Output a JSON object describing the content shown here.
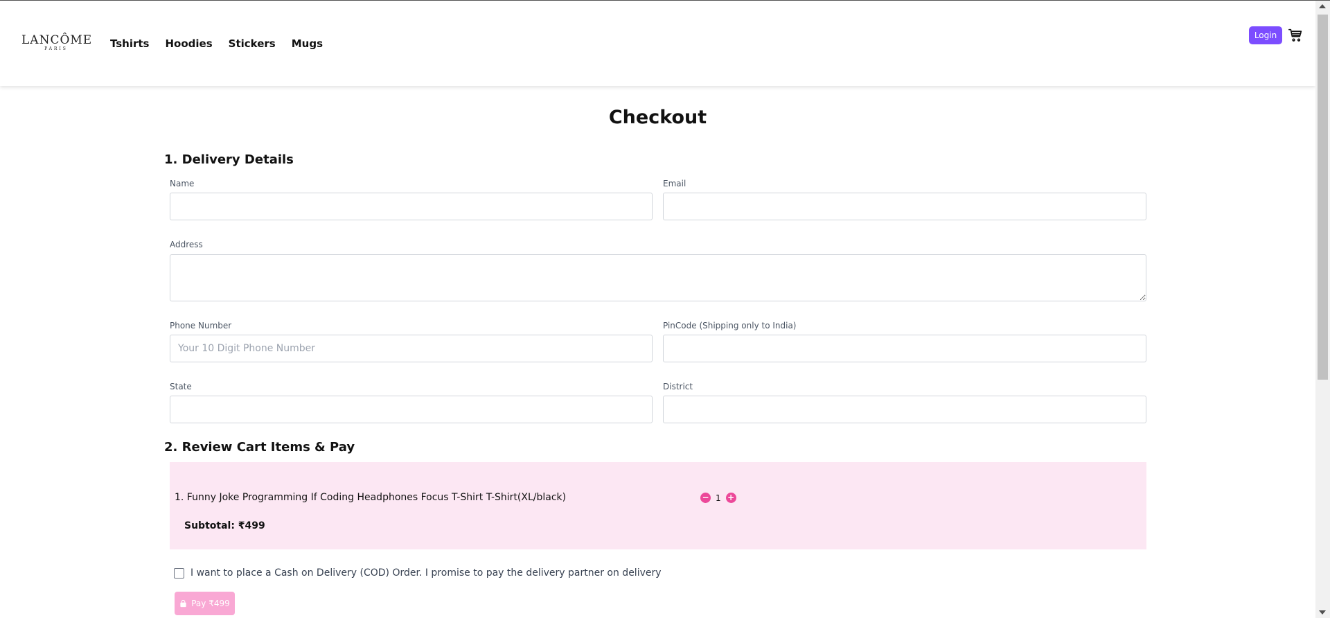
{
  "header": {
    "logo_main": "LANCÔME",
    "logo_sub": "PARIS",
    "nav": [
      {
        "label": "Tshirts"
      },
      {
        "label": "Hoodies"
      },
      {
        "label": "Stickers"
      },
      {
        "label": "Mugs"
      }
    ],
    "login_label": "Login",
    "accent_color": "#7c4dff",
    "cart_icon": "shopping-cart-icon"
  },
  "checkout": {
    "title": "Checkout",
    "delivery_section": "1. Delivery Details",
    "fields": {
      "name": {
        "label": "Name",
        "value": "",
        "placeholder": ""
      },
      "email": {
        "label": "Email",
        "value": "",
        "placeholder": ""
      },
      "address": {
        "label": "Address",
        "value": "",
        "placeholder": ""
      },
      "phone": {
        "label": "Phone Number",
        "value": "",
        "placeholder": "Your 10 Digit Phone Number"
      },
      "pincode": {
        "label": "PinCode (Shipping only to India)",
        "value": "",
        "placeholder": ""
      },
      "state": {
        "label": "State",
        "value": "",
        "placeholder": ""
      },
      "district": {
        "label": "District",
        "value": "",
        "placeholder": ""
      }
    },
    "review_section": "2. Review Cart Items & Pay",
    "cart": {
      "items": [
        {
          "name": "1. Funny Joke Programming If Coding Headphones Focus T-Shirt T-Shirt(XL/black)",
          "qty": "1"
        }
      ],
      "subtotal": "Subtotal: ₹499",
      "background_color": "#fce7f3",
      "accent_color": "#ec4899"
    },
    "cod_label": "I want to place a Cash on Delivery (COD) Order. I promise to pay the delivery partner on delivery",
    "cod_checked": false,
    "pay_label": "Pay ₹499",
    "pay_icon": "shopping-bag-icon"
  }
}
